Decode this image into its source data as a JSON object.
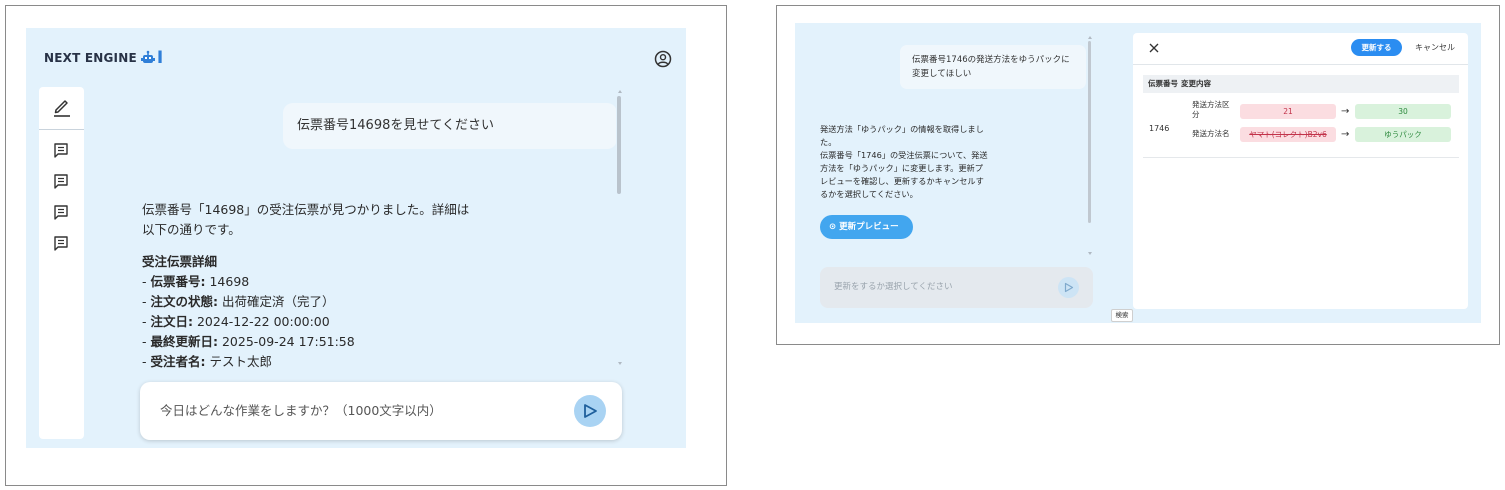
{
  "left": {
    "brand": {
      "name": "NEXT ENGINE",
      "ai_mark": "AI"
    },
    "icons": {
      "user": "user-circle-icon",
      "new_chat": "pencil-icon",
      "history": "chat-history-icon",
      "send": "send-arrow-icon"
    },
    "sidebar": {
      "history_count": 4
    },
    "user_message": "伝票番号14698を見せてください",
    "response": {
      "intro_line1": "伝票番号「14698」の受注伝票が見つかりました。詳細は",
      "intro_line2": "以下の通りです。",
      "heading": "受注伝票詳細",
      "rows": [
        {
          "label": "伝票番号:",
          "value": " 14698"
        },
        {
          "label": "注文の状態:",
          "value": " 出荷確定済（完了）"
        },
        {
          "label": "注文日:",
          "value": " 2024-12-22 00:00:00"
        },
        {
          "label": "最終更新日:",
          "value": " 2025-09-24 17:51:58"
        },
        {
          "label": "受注者名:",
          "value": " テスト太郎"
        }
      ]
    },
    "input": {
      "placeholder": "今日はどんな作業をしますか？（1000文字以内）"
    }
  },
  "right": {
    "user_message_line1": "伝票番号1746の発送方法をゆうパックに",
    "user_message_line2": "変更してほしい",
    "response_lines": [
      "発送方法「ゆうパック」の情報を取得しまし",
      "た。",
      "伝票番号「1746」の受注伝票について、発送",
      "方法を「ゆうパック」に変更します。更新プ",
      "レビューを確認し、更新するかキャンセルす",
      "るかを選択してください。"
    ],
    "preview_button": "⊙ 更新プレビュー",
    "input_placeholder": "更新をするか選択してください",
    "search_tooltip": "検索",
    "panel": {
      "close": "×",
      "update_button": "更新する",
      "cancel_button": "キャンセル",
      "headers": [
        "伝票番号",
        "変更内容"
      ],
      "slip_number": "1746",
      "changes": [
        {
          "field_line1": "発送方法区",
          "field_line2": "分",
          "old": "21",
          "new": "30"
        },
        {
          "field_line1": "発送方法名",
          "field_line2": "",
          "old": "ヤマト(コレクト)B2v6",
          "new": "ゆうパック"
        }
      ],
      "arrow": "→"
    },
    "colors": {
      "app_bg": "#e3f2fc",
      "accent": "#2b8df1",
      "old_bg": "#fbdde1",
      "new_bg": "#d9f2dc"
    }
  }
}
